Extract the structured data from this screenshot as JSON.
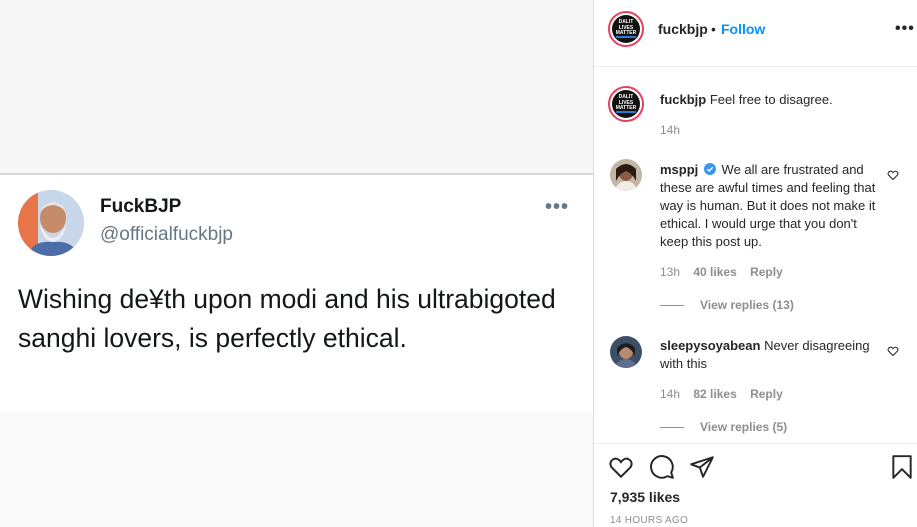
{
  "tweet": {
    "name": "FuckBJP",
    "handle": "@officialfuckbjp",
    "more": "•••",
    "text": "Wishing de¥th upon modi and his ultrabigoted sanghi lovers, is perfectly ethical."
  },
  "post_header": {
    "username": "fuckbjp",
    "dot": "•",
    "follow_label": "Follow",
    "more": "•••",
    "avatar_text": "DALIT LIVES MATTER"
  },
  "caption": {
    "username": "fuckbjp",
    "text": "Feel free to disagree.",
    "time": "14h"
  },
  "comments": [
    {
      "username": "msppj",
      "verified": true,
      "text": "We all are frustrated and these are awful times and feeling that way is human. But it does not make it ethical. I would urge that you don't keep this post up.",
      "time": "13h",
      "likes": "40 likes",
      "reply_label": "Reply",
      "view_replies": "View replies (13)"
    },
    {
      "username": "sleepysoyabean",
      "verified": false,
      "text": "Never disagreeing with this",
      "time": "14h",
      "likes": "82 likes",
      "reply_label": "Reply",
      "view_replies": "View replies (5)"
    }
  ],
  "actions": {
    "icons": [
      "heart-icon",
      "comment-icon",
      "share-icon",
      "bookmark-icon"
    ],
    "likes": "7,935 likes",
    "timestamp": "14 HOURS AGO"
  },
  "colors": {
    "accent": "#0095f6",
    "text": "#262626",
    "muted": "#8e8e8e",
    "verified": "#3897f0"
  }
}
